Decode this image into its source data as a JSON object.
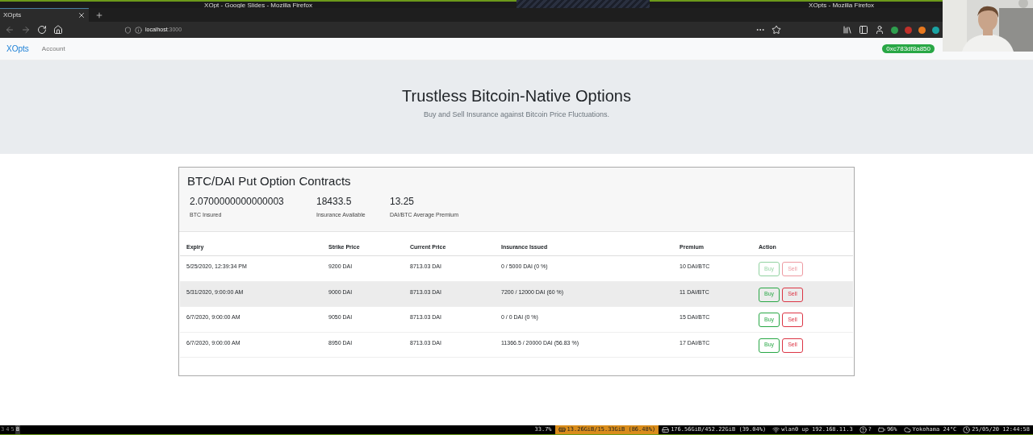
{
  "window_titles": [
    "XOpt - Google Slides - Mozilla Firefox",
    "XOpts - Mozilla Firefox"
  ],
  "tab": {
    "title": "XOpts"
  },
  "address_bar": {
    "host": "localhost",
    "port": ":3000"
  },
  "navbar": {
    "brand": "XOpts",
    "links": [
      "Account"
    ],
    "wallet": "0xc783df8a850"
  },
  "hero": {
    "title": "Trustless Bitcoin-Native Options",
    "subtitle": "Buy and Sell Insurance against Bitcoin Price Fluctuations."
  },
  "card": {
    "title": "BTC/DAI Put Option Contracts",
    "stats": [
      {
        "value": "2.0700000000000003",
        "label": "BTC Insured"
      },
      {
        "value": "18433.5",
        "label": "Insurance Available"
      },
      {
        "value": "13.25",
        "label": "DAI/BTC Average Premium"
      }
    ]
  },
  "table": {
    "columns": [
      "Expiry",
      "Strike Price",
      "Current Price",
      "Insurance Issued",
      "Premium",
      "Action"
    ],
    "rows": [
      {
        "cells": [
          "5/25/2020, 12:39:34 PM",
          "9200 DAI",
          "8713.03 DAI",
          "0 / 5000 DAI (0 %)",
          "10 DAI/BTC"
        ],
        "buy": "Buy",
        "sell": "Sell",
        "disabled": true,
        "selected": false
      },
      {
        "cells": [
          "5/31/2020, 9:00:00 AM",
          "9000 DAI",
          "8713.03 DAI",
          "7200 / 12000 DAI (60 %)",
          "11 DAI/BTC"
        ],
        "buy": "Buy",
        "sell": "Sell",
        "disabled": false,
        "selected": true
      },
      {
        "cells": [
          "6/7/2020, 9:00:00 AM",
          "9050 DAI",
          "8713.03 DAI",
          "0 / 0 DAI (0 %)",
          "15 DAI/BTC"
        ],
        "buy": "Buy",
        "sell": "Sell",
        "disabled": false,
        "selected": false
      },
      {
        "cells": [
          "6/7/2020, 9:00:00 AM",
          "8950 DAI",
          "8713.03 DAI",
          "11366.5 / 20000 DAI (56.83 %)",
          "17 DAI/BTC"
        ],
        "buy": "Buy",
        "sell": "Sell",
        "disabled": false,
        "selected": false
      }
    ]
  },
  "status_bar": {
    "workspaces": [
      {
        "label": "3",
        "selected": false
      },
      {
        "label": "4",
        "selected": false
      },
      {
        "label": "5",
        "selected": false
      },
      {
        "label": "8",
        "selected": true
      }
    ],
    "items": [
      "33.7%",
      "13.26GiB/15.33GiB (86.48%)",
      "176.56GiB/452.22GiB (39.04%)",
      "wlan0 up 192.168.11.3",
      "?",
      "96%",
      "Yokohama 24°C",
      "25/05/20 12:44:58"
    ]
  }
}
